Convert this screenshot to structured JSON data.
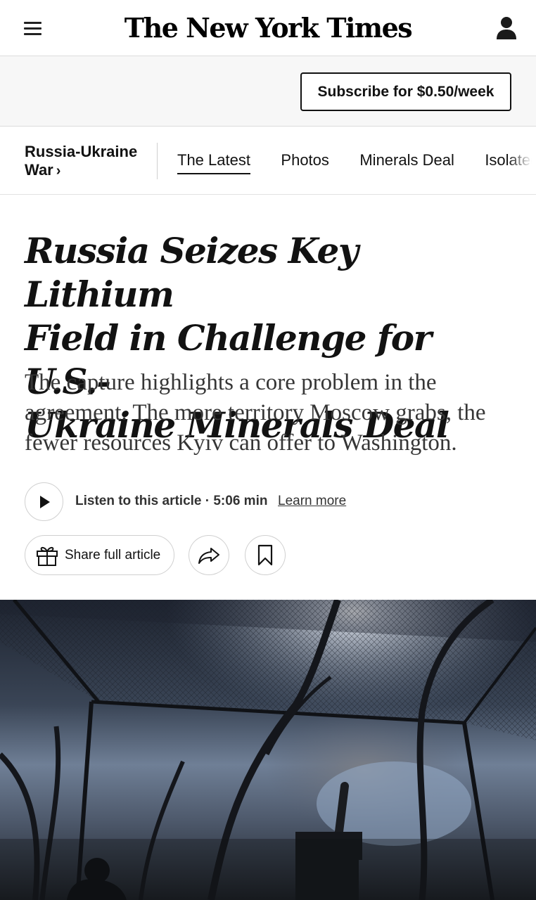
{
  "header": {
    "logo_text": "The New York Times",
    "menu_icon": "hamburger-menu-icon",
    "account_icon": "user-account-icon"
  },
  "subscribe": {
    "label": "Subscribe for $0.50/week"
  },
  "section_nav": {
    "title": "Russia-Ukraine War",
    "title_line1": "Russia-Ukraine",
    "title_line2": "War",
    "chevron": "›",
    "tabs": [
      {
        "label": "The Latest",
        "active": true
      },
      {
        "label": "Photos",
        "active": false
      },
      {
        "label": "Minerals Deal",
        "active": false
      },
      {
        "label": "Isolated C",
        "active": false
      }
    ]
  },
  "article": {
    "headline": "Russia Seizes Key Lithium Field in Challenge for U.S.-Ukraine Minerals Deal",
    "headline_lines": [
      "Russia Seizes Key Lithium",
      "Field in Challenge for U.S.-",
      "Ukraine Minerals Deal"
    ],
    "summary": "The capture highlights a core problem in the agreement. The more territory Moscow grabs, the fewer resources Kyiv can offer to Washington.",
    "summary_lines": [
      "The capture highlights a core problem in the",
      "agreement. The more territory Moscow grabs, the",
      "fewer resources Kyiv can offer to Washington."
    ]
  },
  "listen": {
    "label": "Listen to this article · 5:06 min",
    "learn_more": "Learn more",
    "play_icon": "play-icon"
  },
  "share": {
    "share_full_label": "Share full article",
    "gift_icon": "gift-icon",
    "share_icon": "share-arrow-icon",
    "bookmark_icon": "bookmark-icon"
  },
  "colors": {
    "text": "#121212",
    "border": "#dcdcdc",
    "subbar_bg": "#f7f7f7"
  }
}
